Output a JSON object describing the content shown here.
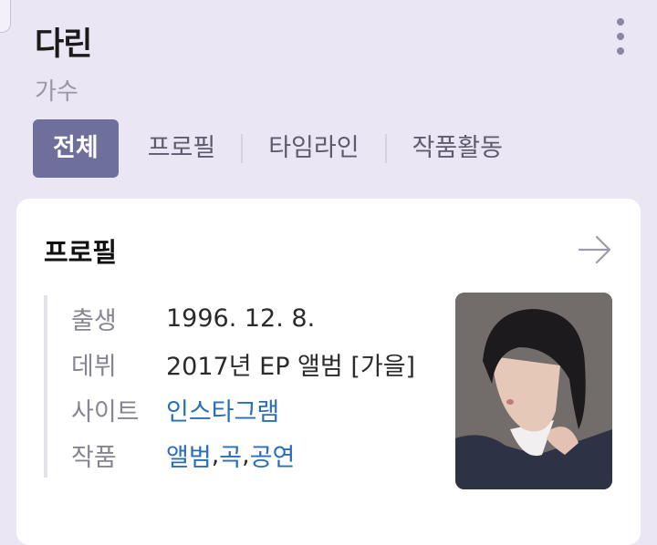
{
  "header": {
    "name": "다린",
    "subtitle": "가수"
  },
  "tabs": [
    {
      "label": "전체",
      "active": true
    },
    {
      "label": "프로필"
    },
    {
      "label": "타임라인"
    },
    {
      "label": "작품활동"
    }
  ],
  "profile": {
    "title": "프로필",
    "birth": {
      "label": "출생",
      "value": "1996. 12. 8."
    },
    "debut": {
      "label": "데뷔",
      "value": "2017년 EP 앨범 [가을]"
    },
    "site": {
      "label": "사이트",
      "link": "인스타그램"
    },
    "works": {
      "label": "작품",
      "links": [
        "앨범",
        "곡",
        "공연"
      ],
      "separator": ", "
    }
  },
  "icons": {
    "more": "more-vertical-icon",
    "arrow": "arrow-right-icon"
  },
  "colors": {
    "background": "#ebe6f3",
    "tab_active": "#6e6f9b",
    "link": "#2a6fb6"
  }
}
